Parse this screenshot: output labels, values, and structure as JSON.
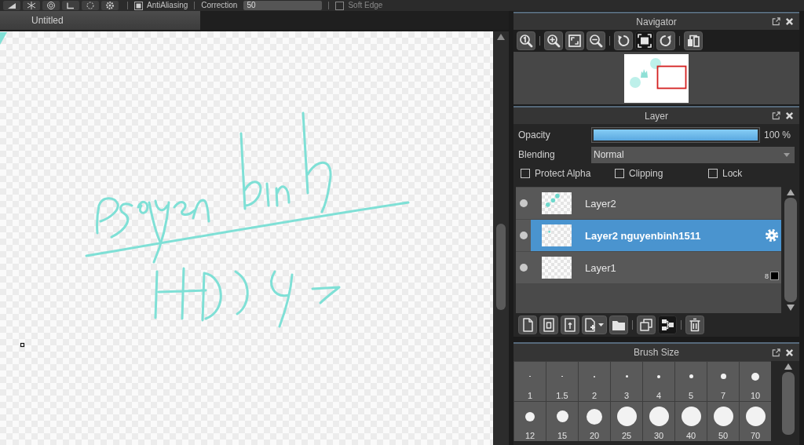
{
  "toolbar": {
    "antialiasing": {
      "label": "AntiAliasing",
      "checked": true
    },
    "correction": {
      "label": "Correction",
      "value": "50"
    },
    "soft_edge": {
      "label": "Soft Edge",
      "checked": false
    }
  },
  "document_tabs": [
    {
      "label": "Untitled",
      "selected": true
    }
  ],
  "navigator": {
    "title": "Navigator",
    "tools": [
      {
        "selected": false
      },
      {
        "selected": false
      },
      {
        "selected": false
      },
      {
        "selected": false
      },
      {
        "selected": false
      },
      {
        "selected": true
      },
      {
        "selected": false
      },
      {
        "selected": false
      }
    ]
  },
  "layer_panel": {
    "title": "Layer",
    "opacity": {
      "label": "Opacity",
      "level": 1,
      "reading": "100 %"
    },
    "blending": {
      "label": "Blending",
      "value": "Normal"
    },
    "options": [
      {
        "label": "Protect Alpha",
        "checked": false
      },
      {
        "label": "Clipping",
        "checked": false
      },
      {
        "label": "Lock",
        "checked": false
      }
    ],
    "layers": [
      {
        "name": "Layer2",
        "visible": true,
        "selected": false
      },
      {
        "name": "Layer2 nguyenbinh1511",
        "visible": true,
        "selected": true
      },
      {
        "name": "Layer1",
        "visible": true,
        "selected": false,
        "badge": "8"
      }
    ],
    "tools": [
      {
        "selected": false
      },
      {
        "selected": false
      },
      {
        "selected": false
      },
      {
        "selected": false
      },
      {
        "selected": false
      },
      {
        "selected": false
      },
      {
        "selected": true
      },
      {
        "selected": false
      }
    ]
  },
  "brush_size": {
    "title": "Brush Size",
    "sizes": [
      {
        "label": "1"
      },
      {
        "label": "1.5"
      },
      {
        "label": "2"
      },
      {
        "label": "3"
      },
      {
        "label": "4"
      },
      {
        "label": "5"
      },
      {
        "label": "7"
      },
      {
        "label": "10"
      },
      {
        "label": "12"
      },
      {
        "label": "15"
      },
      {
        "label": "20"
      },
      {
        "label": "25"
      },
      {
        "label": "30"
      },
      {
        "label": "40"
      },
      {
        "label": "50"
      },
      {
        "label": "70"
      }
    ]
  }
}
